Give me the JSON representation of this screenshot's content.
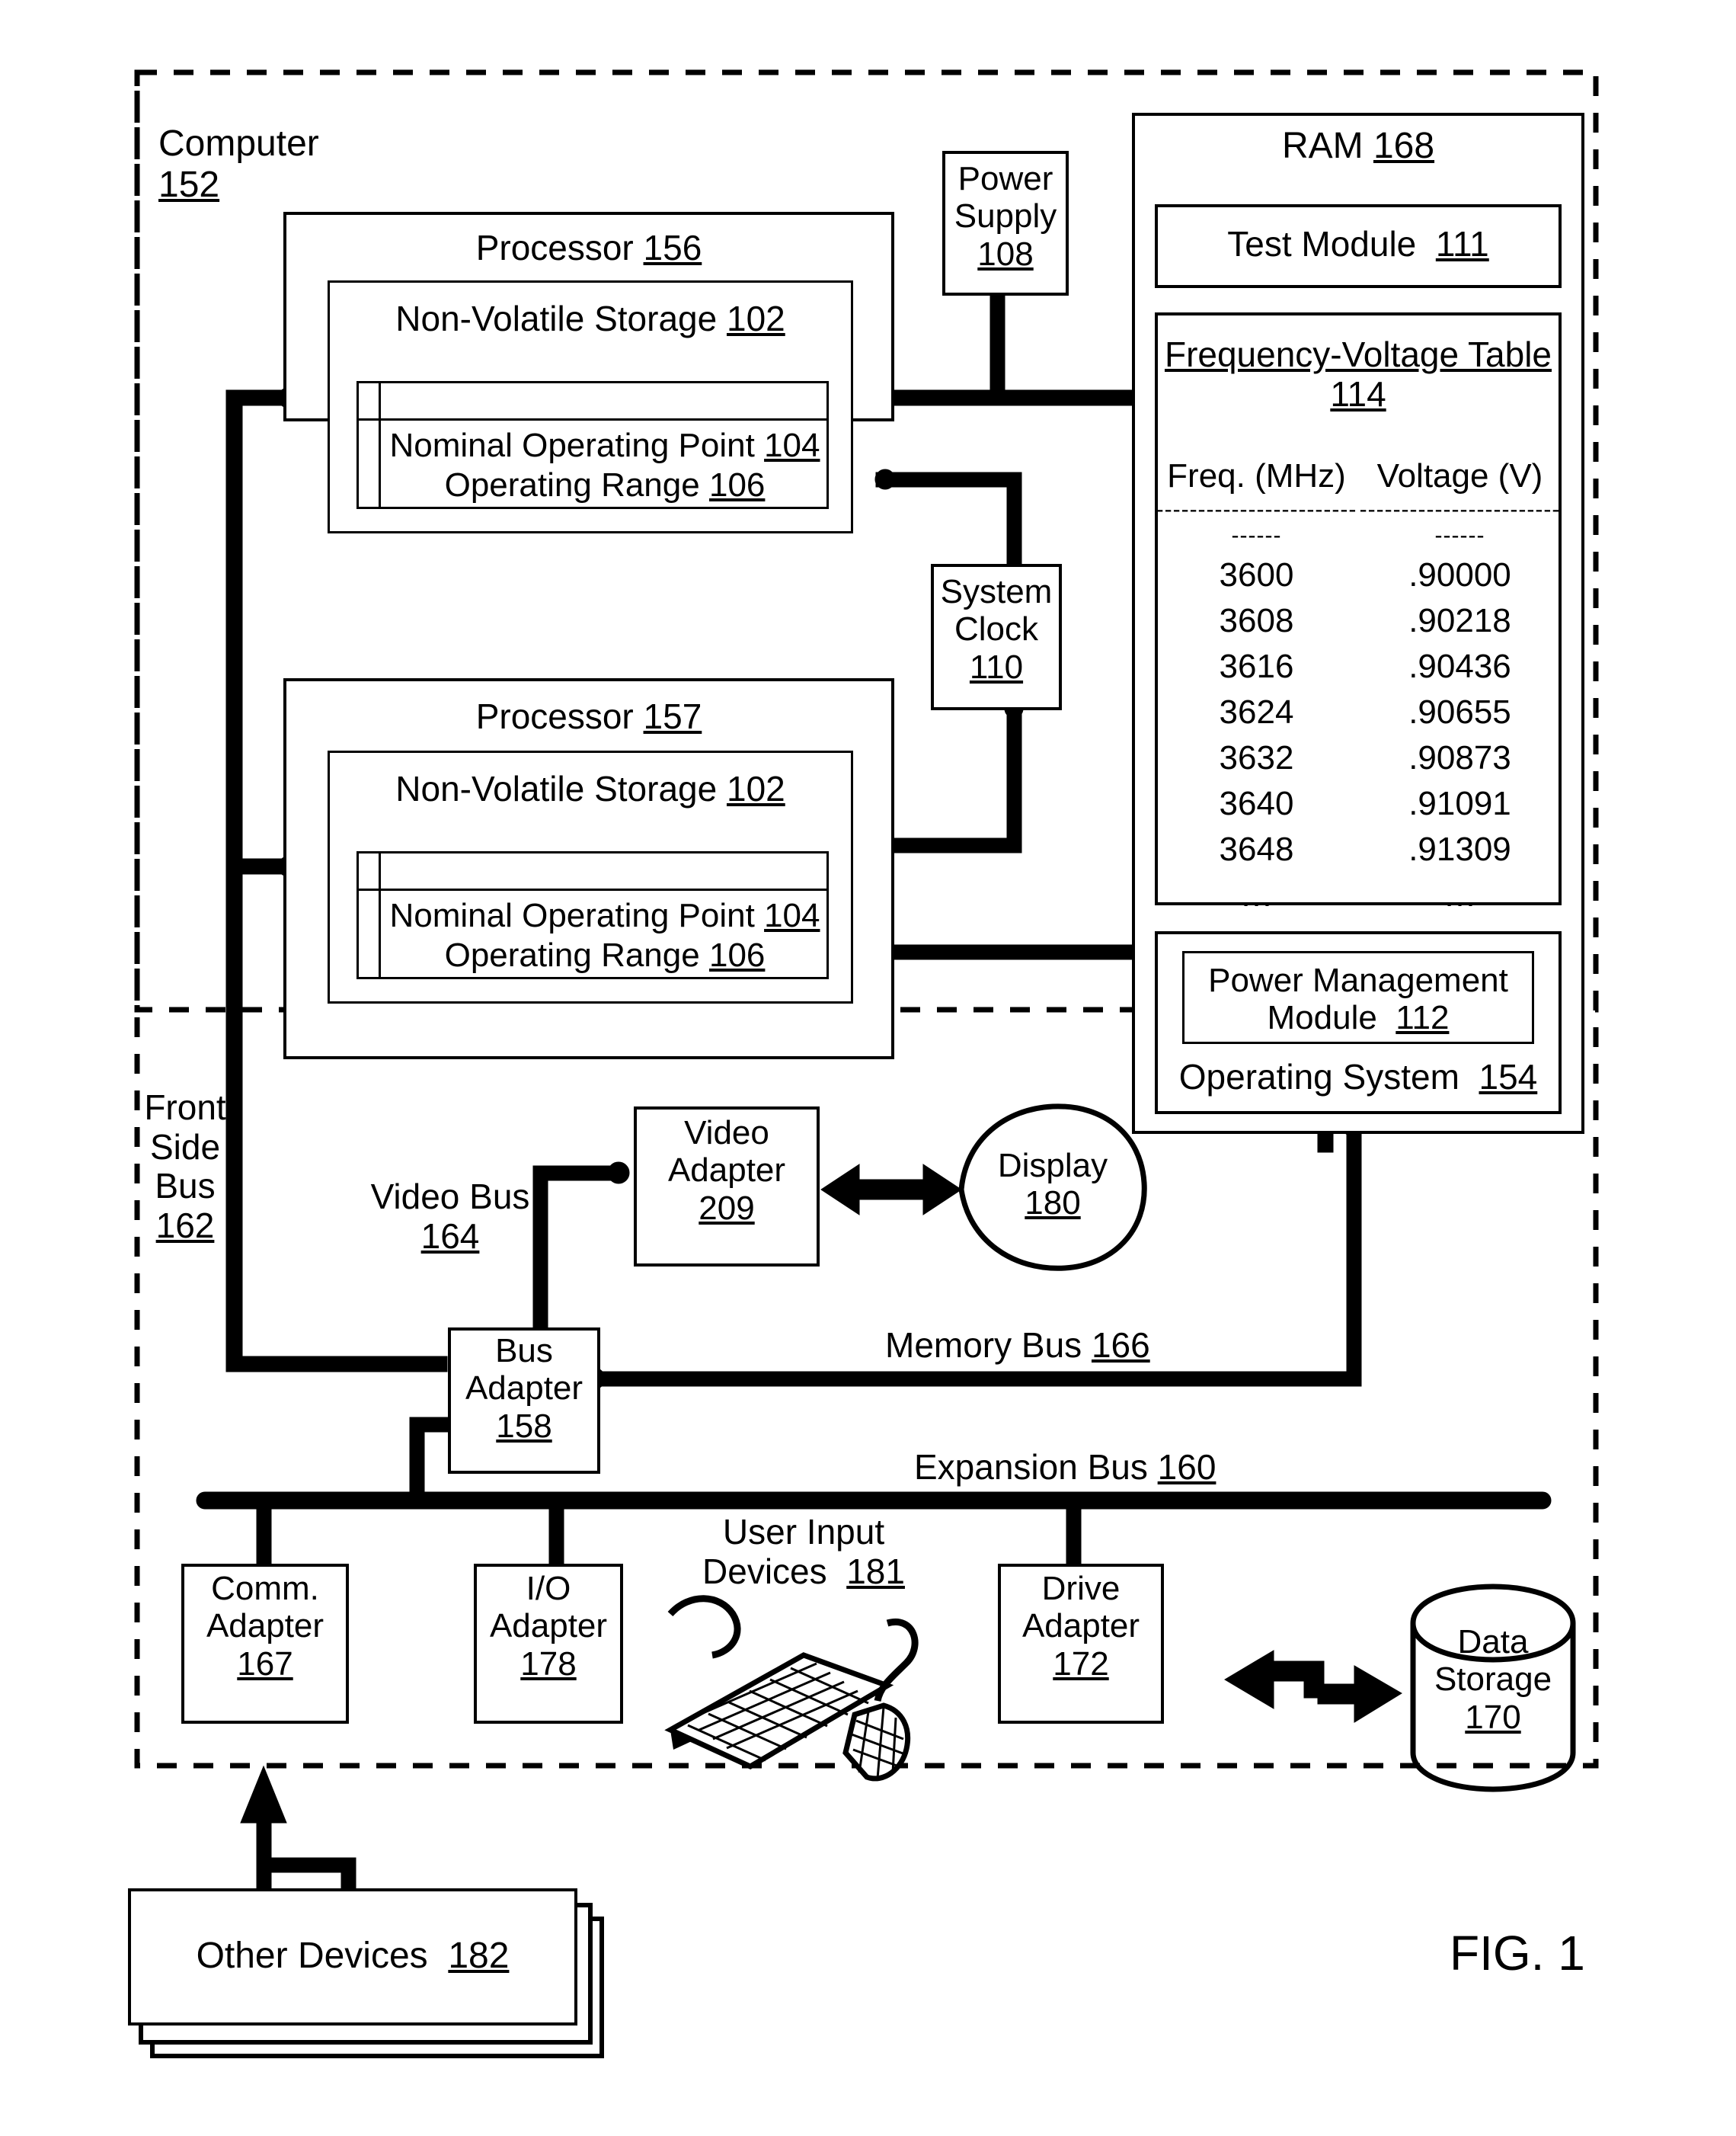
{
  "figure": {
    "caption": "FIG. 1"
  },
  "computer": {
    "label": "Computer",
    "ref": "152"
  },
  "processors": [
    {
      "title": "Processor",
      "ref": "156",
      "storage": {
        "title": "Non-Volatile Storage",
        "ref": "102"
      },
      "nominal": {
        "title": "Nominal Operating Point",
        "ref": "104"
      },
      "range": {
        "title": "Operating Range",
        "ref": "106"
      }
    },
    {
      "title": "Processor",
      "ref": "157",
      "storage": {
        "title": "Non-Volatile Storage",
        "ref": "102"
      },
      "nominal": {
        "title": "Nominal Operating Point",
        "ref": "104"
      },
      "range": {
        "title": "Operating Range",
        "ref": "106"
      }
    }
  ],
  "power_supply": {
    "line1": "Power",
    "line2": "Supply",
    "ref": "108"
  },
  "system_clock": {
    "line1": "System",
    "line2": "Clock",
    "ref": "110"
  },
  "ram": {
    "title": "RAM",
    "ref": "168",
    "test_module": {
      "title": "Test Module",
      "ref": "111"
    },
    "freq_table": {
      "title": "Frequency-Voltage Table",
      "ref": "114",
      "col_freq": "Freq. (MHz)",
      "col_volt": "Voltage (V)",
      "rule": "------------------------------",
      "ellipsis": "…"
    },
    "power_mgmt": {
      "line1": "Power Management",
      "line2": "Module",
      "ref": "112"
    },
    "operating_system": {
      "title": "Operating System",
      "ref": "154"
    }
  },
  "chart_data": {
    "type": "table",
    "title": "Frequency-Voltage Table 114",
    "columns": [
      "Freq. (MHz)",
      "Voltage (V)"
    ],
    "rows": [
      [
        "3600",
        ".90000"
      ],
      [
        "3608",
        ".90218"
      ],
      [
        "3616",
        ".90436"
      ],
      [
        "3624",
        ".90655"
      ],
      [
        "3632",
        ".90873"
      ],
      [
        "3640",
        ".91091"
      ],
      [
        "3648",
        ".91309"
      ],
      [
        "…",
        "…"
      ]
    ]
  },
  "buses": {
    "front_side": {
      "l1": "Front",
      "l2": "Side",
      "l3": "Bus",
      "ref": "162"
    },
    "video": {
      "title": "Video Bus",
      "ref": "164"
    },
    "memory": {
      "title": "Memory Bus",
      "ref": "166"
    },
    "expansion": {
      "title": "Expansion Bus",
      "ref": "160"
    }
  },
  "video_adapter": {
    "line1": "Video",
    "line2": "Adapter",
    "ref": "209"
  },
  "display": {
    "title": "Display",
    "ref": "180"
  },
  "bus_adapter": {
    "line1": "Bus",
    "line2": "Adapter",
    "ref": "158"
  },
  "comm_adapter": {
    "line1": "Comm.",
    "line2": "Adapter",
    "ref": "167"
  },
  "io_adapter": {
    "line1": "I/O",
    "line2": "Adapter",
    "ref": "178"
  },
  "drive_adapter": {
    "line1": "Drive",
    "line2": "Adapter",
    "ref": "172"
  },
  "data_storage": {
    "line1": "Data",
    "line2": "Storage",
    "ref": "170"
  },
  "user_input": {
    "line1": "User Input",
    "line2": "Devices",
    "ref": "181"
  },
  "other_devices": {
    "title": "Other Devices",
    "ref": "182"
  }
}
